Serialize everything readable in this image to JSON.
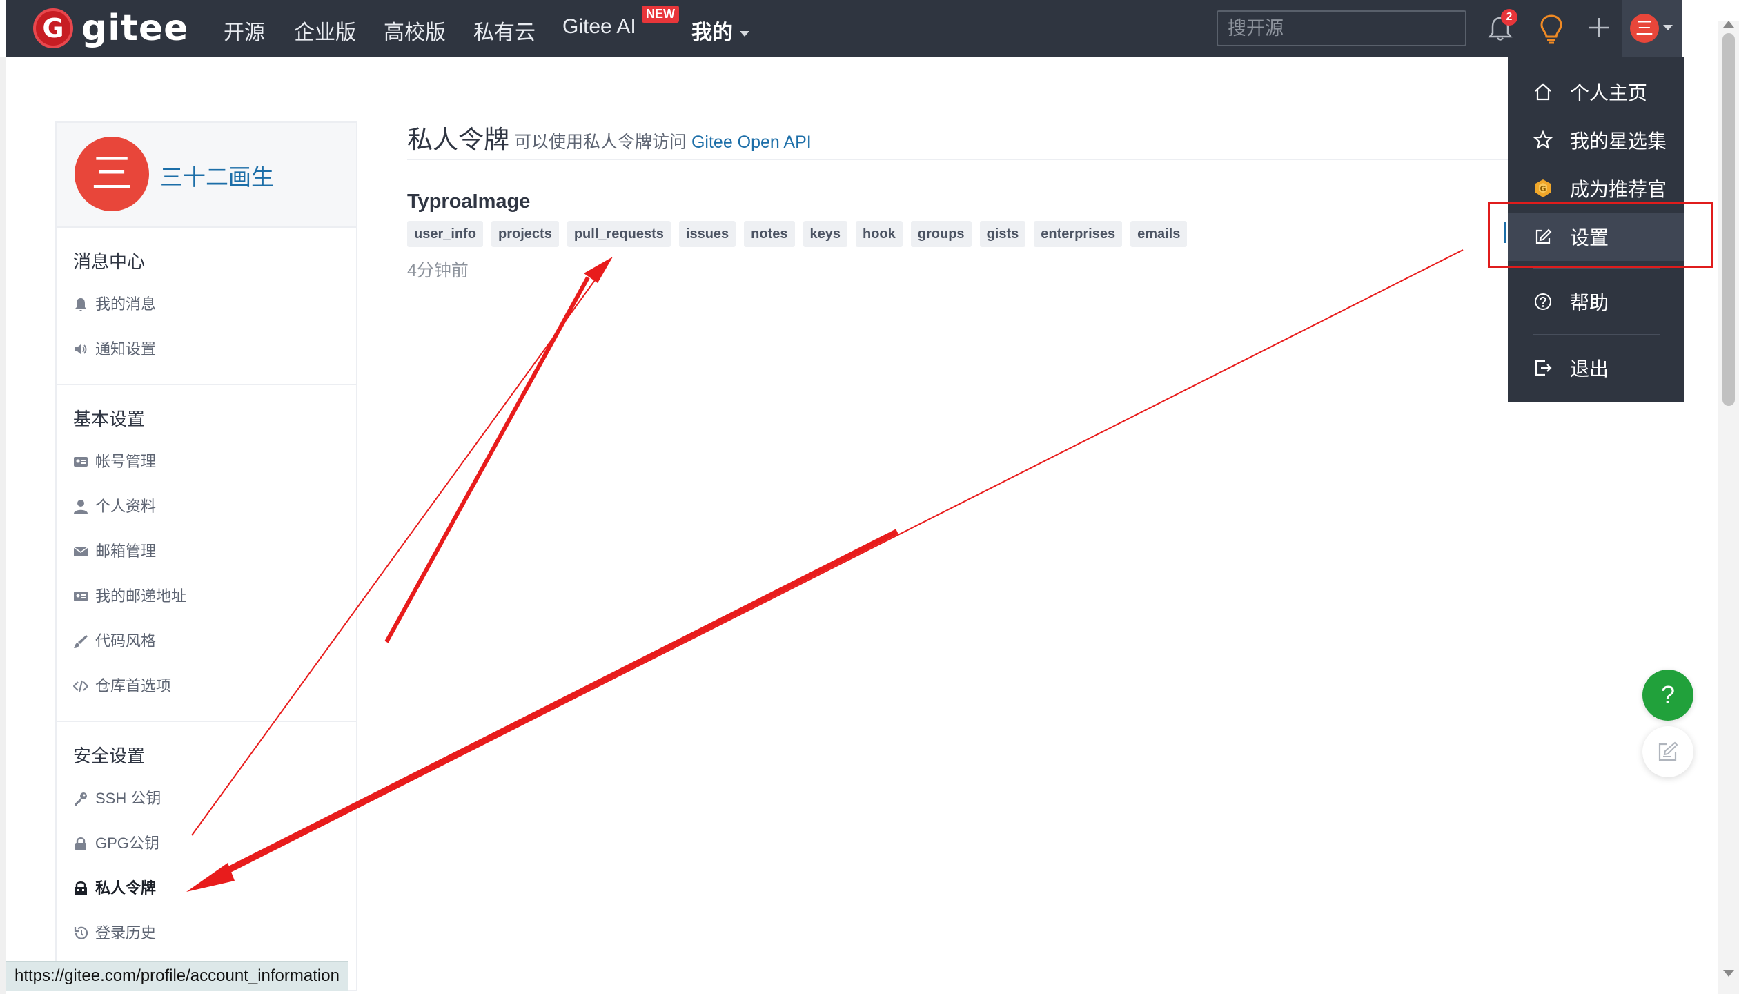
{
  "nav": {
    "brand": "gitee",
    "logo_letter": "G",
    "items": [
      "开源",
      "企业版",
      "高校版",
      "私有云",
      "Gitee AI",
      "我的"
    ],
    "new_badge": "NEW",
    "search_placeholder": "搜开源",
    "notification_count": "2",
    "avatar_char": "三"
  },
  "sidebar": {
    "avatar_char": "三",
    "username": "三十二画生",
    "sections": [
      {
        "title": "消息中心",
        "items": [
          {
            "label": "我的消息",
            "icon": "bell-icon"
          },
          {
            "label": "通知设置",
            "icon": "speaker-icon"
          }
        ]
      },
      {
        "title": "基本设置",
        "items": [
          {
            "label": "帐号管理",
            "icon": "id-card-icon"
          },
          {
            "label": "个人资料",
            "icon": "user-icon"
          },
          {
            "label": "邮箱管理",
            "icon": "envelope-icon"
          },
          {
            "label": "我的邮递地址",
            "icon": "address-card-icon"
          },
          {
            "label": "代码风格",
            "icon": "brush-icon"
          },
          {
            "label": "仓库首选项",
            "icon": "code-icon"
          }
        ]
      },
      {
        "title": "安全设置",
        "items": [
          {
            "label": "SSH 公钥",
            "icon": "key-icon"
          },
          {
            "label": "GPG公钥",
            "icon": "lock-icon"
          },
          {
            "label": "私人令牌",
            "icon": "token-icon",
            "active": true
          },
          {
            "label": "登录历史",
            "icon": "history-icon"
          }
        ]
      }
    ]
  },
  "main": {
    "title": "私人令牌",
    "subtitle_prefix": "可以使用私人令牌访问",
    "subtitle_link": "Gitee Open API",
    "token": {
      "name": "TyproaImage",
      "scopes": [
        "user_info",
        "projects",
        "pull_requests",
        "issues",
        "notes",
        "keys",
        "hook",
        "groups",
        "gists",
        "enterprises",
        "emails"
      ],
      "time": "4分钟前"
    }
  },
  "dropdown": {
    "items": [
      {
        "label": "个人主页",
        "icon": "home-icon"
      },
      {
        "label": "我的星选集",
        "icon": "star-icon"
      },
      {
        "label": "成为推荐官",
        "icon": "badge-icon"
      },
      {
        "label": "设置",
        "icon": "edit-icon",
        "active": true
      },
      {
        "label": "帮助",
        "icon": "help-circle-icon"
      },
      {
        "label": "退出",
        "icon": "logout-icon"
      }
    ]
  },
  "floating": {
    "help_label": "?"
  },
  "status_url": "https://gitee.com/profile/account_information",
  "colors": {
    "nav_bg": "#2f3540",
    "link": "#1c6ea8",
    "avatar": "#e8463a",
    "annotation": "#e01c1c",
    "help": "#21a13b"
  }
}
